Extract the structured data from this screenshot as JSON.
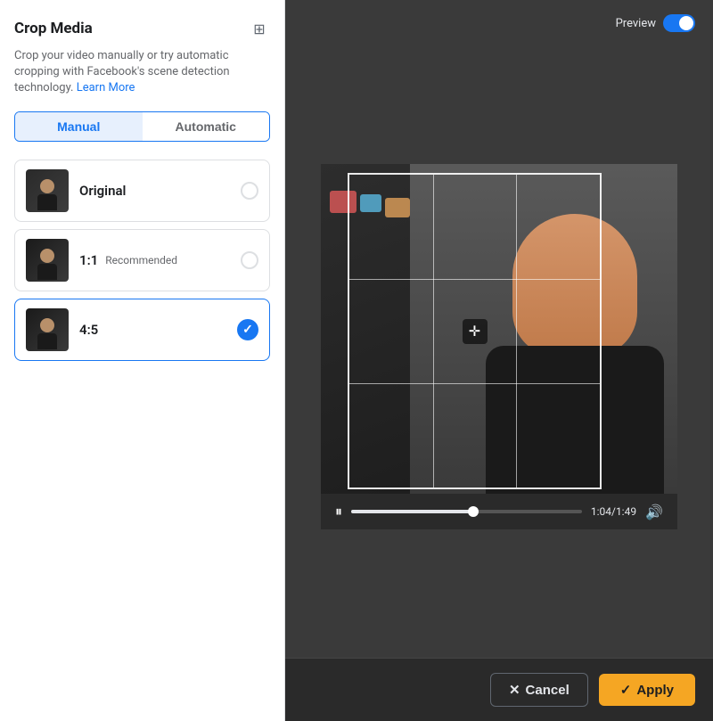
{
  "panel": {
    "title": "Crop Media",
    "description": "Crop your video manually or try automatic cropping with Facebook's scene detection technology.",
    "learn_more": "Learn More",
    "icon": "⊞"
  },
  "tabs": {
    "manual": "Manual",
    "automatic": "Automatic",
    "active": "manual"
  },
  "crop_options": [
    {
      "id": "original",
      "label": "Original",
      "badge": "",
      "selected": false
    },
    {
      "id": "1-1",
      "label": "1:1",
      "badge": "Recommended",
      "selected": false
    },
    {
      "id": "4-5",
      "label": "4:5",
      "badge": "",
      "selected": true
    }
  ],
  "preview": {
    "label": "Preview",
    "toggle_on": true
  },
  "video": {
    "time_current": "1:04",
    "time_total": "1:49",
    "progress_percent": 53
  },
  "actions": {
    "cancel": "Cancel",
    "apply": "Apply"
  }
}
